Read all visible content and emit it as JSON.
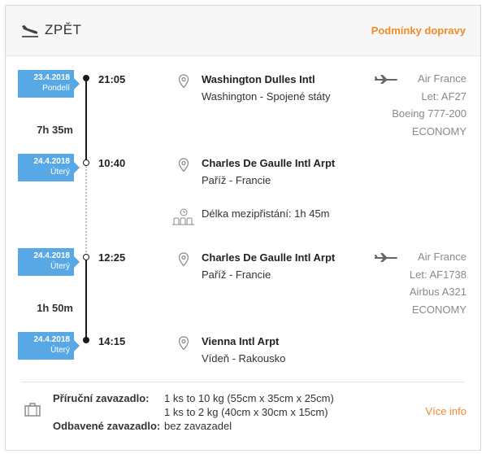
{
  "header": {
    "icon": "plane-landing-icon",
    "title": "ZPĚT",
    "conditions_link": "Podmínky dopravy"
  },
  "segments": [
    {
      "departure": {
        "date": "23.4.2018",
        "day": "Pondelí",
        "time": "21:05",
        "airport": "Washington Dulles Intl",
        "city": "Washington - Spojené státy"
      },
      "duration": "7h 35m",
      "arrival": {
        "date": "24.4.2018",
        "day": "Úterý",
        "time": "10:40",
        "airport": "Charles De Gaulle Intl Arpt",
        "city": "Paříž - Francie"
      },
      "airline": "Air France",
      "flight": "Let: AF27",
      "aircraft": "Boeing 777-200",
      "cabin": "ECONOMY"
    },
    {
      "departure": {
        "date": "24.4.2018",
        "day": "Úterý",
        "time": "12:25",
        "airport": "Charles De Gaulle Intl Arpt",
        "city": "Paříž - Francie"
      },
      "duration": "1h 50m",
      "arrival": {
        "date": "24.4.2018",
        "day": "Úterý",
        "time": "14:15",
        "airport": "Vienna Intl Arpt",
        "city": "Vídeň - Rakousko"
      },
      "airline": "Air France",
      "flight": "Let: AF1738",
      "aircraft": "Airbus A321",
      "cabin": "ECONOMY"
    }
  ],
  "layover": "Délka mezipřistání: 1h 45m",
  "baggage": {
    "cabin_label": "Příruční zavazadlo:",
    "cabin_values": [
      "1 ks to 10 kg (55cm x 35cm x 25cm)",
      "1 ks to 2 kg (40cm x 30cm x 15cm)"
    ],
    "checked_label": "Odbavené zavazadlo:",
    "checked_value": "bez zavazadel",
    "more_link": "Více info"
  },
  "colors": {
    "accent": "#f08c2a",
    "badge": "#59a8e6"
  }
}
